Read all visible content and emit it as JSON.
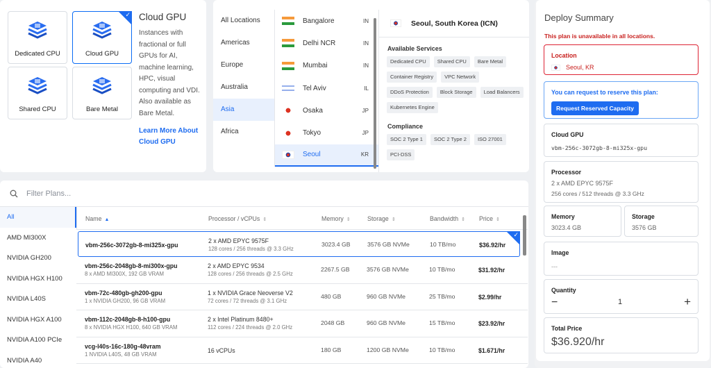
{
  "server_type": {
    "tiles": [
      {
        "label": "Dedicated CPU",
        "icon": "dedicated-cpu-icon",
        "selected": false
      },
      {
        "label": "Cloud GPU",
        "icon": "cloud-gpu-icon",
        "selected": true
      },
      {
        "label": "Shared CPU",
        "icon": "shared-cpu-icon",
        "selected": false
      },
      {
        "label": "Bare Metal",
        "icon": "bare-metal-icon",
        "selected": false
      }
    ],
    "title": "Cloud GPU",
    "description": "Instances with fractional or full GPUs for AI, machine learning, HPC, visual computing and VDI. Also available as Bare Metal.",
    "learn_more": "Learn More About Cloud GPU"
  },
  "locations": {
    "regions": [
      "All Locations",
      "Americas",
      "Europe",
      "Australia",
      "Asia",
      "Africa"
    ],
    "selected_region": "Asia",
    "cities": [
      {
        "name": "Bangalore",
        "code": "IN",
        "flag": "flag-in"
      },
      {
        "name": "Delhi NCR",
        "code": "IN",
        "flag": "flag-in"
      },
      {
        "name": "Mumbai",
        "code": "IN",
        "flag": "flag-in"
      },
      {
        "name": "Tel Aviv",
        "code": "IL",
        "flag": "flag-il"
      },
      {
        "name": "Osaka",
        "code": "JP",
        "flag": "flag-jp"
      },
      {
        "name": "Tokyo",
        "code": "JP",
        "flag": "flag-jp"
      },
      {
        "name": "Seoul",
        "code": "KR",
        "flag": "flag-kr"
      }
    ],
    "selected_city": "Seoul",
    "detail": {
      "title": "Seoul, South Korea (ICN)",
      "services_title": "Available Services",
      "services": [
        "Dedicated CPU",
        "Shared CPU",
        "Bare Metal",
        "Container Registry",
        "VPC Network",
        "DDoS Protection",
        "Block Storage",
        "Load Balancers",
        "Kubernetes Engine"
      ],
      "compliance_title": "Compliance",
      "compliance": [
        "SOC 2 Type 1",
        "SOC 2 Type 2",
        "ISO 27001",
        "PCI-DSS"
      ]
    }
  },
  "plans": {
    "filter_placeholder": "Filter Plans...",
    "categories": [
      "All",
      "AMD MI300X",
      "NVIDIA GH200",
      "NVIDIA HGX H100",
      "NVIDIA L40S",
      "NVIDIA HGX A100",
      "NVIDIA A100 PCIe",
      "NVIDIA A40"
    ],
    "selected_category": "All",
    "columns": [
      "Name",
      "Processor / vCPUs",
      "Memory",
      "Storage",
      "Bandwidth",
      "Price"
    ],
    "rows": [
      {
        "name": "vbm-256c-3072gb-8-mi325x-gpu",
        "sub": "",
        "proc": "2 x AMD EPYC 9575F",
        "proc_sub": "128 cores / 256 threads @ 3.3 GHz",
        "memory": "3023.4 GB",
        "storage": "3576 GB NVMe",
        "bandwidth": "10 TB/mo",
        "price": "$36.92/hr",
        "selected": true
      },
      {
        "name": "vbm-256c-2048gb-8-mi300x-gpu",
        "sub": "8 x AMD MI300X, 192 GB VRAM",
        "proc": "2 x AMD EPYC 9534",
        "proc_sub": "128 cores / 256 threads @ 2.5 GHz",
        "memory": "2267.5 GB",
        "storage": "3576 GB NVMe",
        "bandwidth": "10 TB/mo",
        "price": "$31.92/hr",
        "selected": false
      },
      {
        "name": "vbm-72c-480gb-gh200-gpu",
        "sub": "1 x NVIDIA GH200, 96 GB VRAM",
        "proc": "1 x NVIDIA Grace Neoverse V2",
        "proc_sub": "72 cores / 72 threads @ 3.1 GHz",
        "memory": "480 GB",
        "storage": "960 GB NVMe",
        "bandwidth": "25 TB/mo",
        "price": "$2.99/hr",
        "selected": false
      },
      {
        "name": "vbm-112c-2048gb-8-h100-gpu",
        "sub": "8 x NVIDIA HGX H100, 640 GB VRAM",
        "proc": "2 x Intel Platinum 8480+",
        "proc_sub": "112 cores / 224 threads @ 2.0 GHz",
        "memory": "2048 GB",
        "storage": "960 GB NVMe",
        "bandwidth": "15 TB/mo",
        "price": "$23.92/hr",
        "selected": false
      },
      {
        "name": "vcg-l40s-16c-180g-48vram",
        "sub": "1 NVIDIA L40S, 48 GB VRAM",
        "proc": "16 vCPUs",
        "proc_sub": "",
        "memory": "180 GB",
        "storage": "1200 GB NVMe",
        "bandwidth": "10 TB/mo",
        "price": "$1.671/hr",
        "selected": false
      }
    ]
  },
  "summary": {
    "title": "Deploy Summary",
    "warning": "This plan is unavailable in all locations.",
    "location_label": "Location",
    "location_value": "Seoul, KR",
    "reserve_text": "You can request to reserve this plan:",
    "reserve_button": "Request Reserved Capacity",
    "gpu_label": "Cloud GPU",
    "gpu_value": "vbm-256c-3072gb-8-mi325x-gpu",
    "processor_label": "Processor",
    "processor_value": "2 x AMD EPYC 9575F",
    "processor_sub": "256 cores / 512 threads @ 3.3 GHz",
    "memory_label": "Memory",
    "memory_value": "3023.4 GB",
    "storage_label": "Storage",
    "storage_value": "3576 GB",
    "image_label": "Image",
    "image_value": "---",
    "quantity_label": "Quantity",
    "quantity_value": "1",
    "total_label": "Total Price",
    "total_value": "$36.920/hr"
  },
  "colors": {
    "accent": "#1e6cf0",
    "error": "#c8201e"
  }
}
